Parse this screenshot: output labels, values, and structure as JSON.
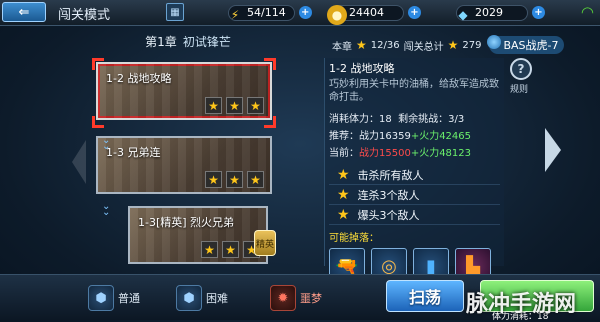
{
  "header": {
    "back_label": "⇐",
    "mode_title": "闯关模式",
    "stamina": "54/114",
    "gold": "24404",
    "diamonds": "2029"
  },
  "chapter": {
    "number": "第1章",
    "name": "初试锋芒"
  },
  "stages": [
    {
      "label": "1-2 战地攻略",
      "stars": 3,
      "selected": true
    },
    {
      "label": "1-3 兄弟连",
      "stars": 3,
      "selected": false
    },
    {
      "label": "1-3[精英] 烈火兄弟",
      "stars": 3,
      "selected": false,
      "badge": "精英"
    }
  ],
  "summary": {
    "chapter_stars_label": "本章",
    "chapter_stars": "12/36",
    "total_label": "闯关总计",
    "total_stars": "279",
    "rank": "BAS战虎-7"
  },
  "detail": {
    "stage_name": "1-2 战地攻略",
    "description": "巧妙利用关卡中的油桶，给敌军造成致命打击。",
    "stamina_label": "消耗体力：",
    "stamina_value": "18",
    "remaining_label": "剩余挑战：",
    "remaining_value": "3/3",
    "recommend_label": "推荐：",
    "recommend_power": "战力16359",
    "recommend_fire": "+火力42465",
    "current_label": "当前：",
    "current_power": "战力15500",
    "current_fire": "+火力48123",
    "objectives": [
      "击杀所有敌人",
      "连杀3个敌人",
      "爆头3个敌人"
    ],
    "drops_label": "可能掉落：",
    "drops": [
      "gun-icon",
      "target-icon",
      "card-icon",
      "block-icon"
    ]
  },
  "rules_label": "规则",
  "bottom": {
    "normal_label": "普通",
    "hard_label": "困难",
    "nightmare_label": "噩梦",
    "sweep_label": "扫荡",
    "stamina_cost": "体力消耗：18"
  },
  "watermark": "脉冲手游网",
  "colors": {
    "accent_blue": "#2d8ae2",
    "star_gold": "#ffc61a",
    "power_red": "#ff4b4b",
    "fire_green": "#6bf06b"
  }
}
